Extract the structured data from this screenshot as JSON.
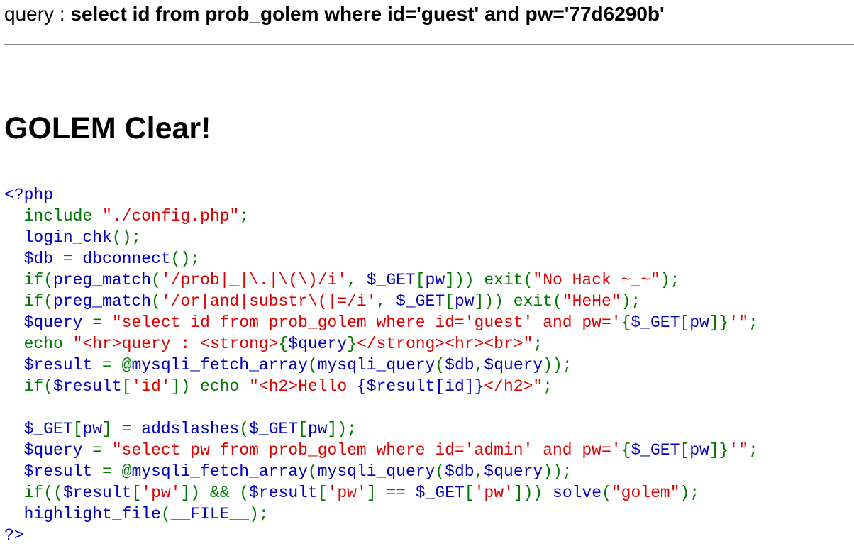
{
  "header": {
    "query_label": "query : ",
    "query_text": "select id from prob_golem where id='guest' and pw='77d6290b'"
  },
  "result": {
    "title": "GOLEM Clear!"
  },
  "source": {
    "lines": [
      [
        [
          "df",
          "<?php"
        ]
      ],
      [
        [
          "df",
          "  "
        ],
        [
          "kw",
          "include "
        ],
        [
          "str",
          "\"./config.php\""
        ],
        [
          "kw",
          ";"
        ]
      ],
      [
        [
          "df",
          "  login_chk"
        ],
        [
          "kw",
          "();"
        ]
      ],
      [
        [
          "df",
          "  $db "
        ],
        [
          "kw",
          "= "
        ],
        [
          "df",
          "dbconnect"
        ],
        [
          "kw",
          "();"
        ]
      ],
      [
        [
          "kw",
          "  if("
        ],
        [
          "df",
          "preg_match"
        ],
        [
          "kw",
          "("
        ],
        [
          "str",
          "'/prob|_|\\.|\\(\\)/i'"
        ],
        [
          "kw",
          ", "
        ],
        [
          "df",
          "$_GET"
        ],
        [
          "kw",
          "["
        ],
        [
          "df",
          "pw"
        ],
        [
          "kw",
          "])) exit("
        ],
        [
          "str",
          "\"No Hack ~_~\""
        ],
        [
          "kw",
          ");"
        ]
      ],
      [
        [
          "kw",
          "  if("
        ],
        [
          "df",
          "preg_match"
        ],
        [
          "kw",
          "("
        ],
        [
          "str",
          "'/or|and|substr\\(|=/i'"
        ],
        [
          "kw",
          ", "
        ],
        [
          "df",
          "$_GET"
        ],
        [
          "kw",
          "["
        ],
        [
          "df",
          "pw"
        ],
        [
          "kw",
          "])) exit("
        ],
        [
          "str",
          "\"HeHe\""
        ],
        [
          "kw",
          ");"
        ]
      ],
      [
        [
          "df",
          "  $query "
        ],
        [
          "kw",
          "= "
        ],
        [
          "str",
          "\"select id from prob_golem where id='guest' and pw='"
        ],
        [
          "kw",
          "{"
        ],
        [
          "df",
          "$_GET"
        ],
        [
          "kw",
          "["
        ],
        [
          "df",
          "pw"
        ],
        [
          "kw",
          "]}"
        ],
        [
          "str",
          "'\""
        ],
        [
          "kw",
          ";"
        ]
      ],
      [
        [
          "kw",
          "  echo "
        ],
        [
          "str",
          "\"<hr>query : <strong>"
        ],
        [
          "kw",
          "{"
        ],
        [
          "df",
          "$query"
        ],
        [
          "kw",
          "}"
        ],
        [
          "str",
          "</strong><hr><br>\""
        ],
        [
          "kw",
          ";"
        ]
      ],
      [
        [
          "df",
          "  $result "
        ],
        [
          "kw",
          "= @"
        ],
        [
          "df",
          "mysqli_fetch_array"
        ],
        [
          "kw",
          "("
        ],
        [
          "df",
          "mysqli_query"
        ],
        [
          "kw",
          "("
        ],
        [
          "df",
          "$db"
        ],
        [
          "kw",
          ","
        ],
        [
          "df",
          "$query"
        ],
        [
          "kw",
          "));"
        ]
      ],
      [
        [
          "kw",
          "  if("
        ],
        [
          "df",
          "$result"
        ],
        [
          "kw",
          "["
        ],
        [
          "str",
          "'id'"
        ],
        [
          "kw",
          "]) echo "
        ],
        [
          "str",
          "\"<h2>Hello "
        ],
        [
          "df",
          "{$result[id]}"
        ],
        [
          "str",
          "</h2>\""
        ],
        [
          "kw",
          ";"
        ]
      ],
      [
        [
          "df",
          ""
        ]
      ],
      [
        [
          "df",
          "  $_GET"
        ],
        [
          "kw",
          "["
        ],
        [
          "df",
          "pw"
        ],
        [
          "kw",
          "] = "
        ],
        [
          "df",
          "addslashes"
        ],
        [
          "kw",
          "("
        ],
        [
          "df",
          "$_GET"
        ],
        [
          "kw",
          "["
        ],
        [
          "df",
          "pw"
        ],
        [
          "kw",
          "]);"
        ]
      ],
      [
        [
          "df",
          "  $query "
        ],
        [
          "kw",
          "= "
        ],
        [
          "str",
          "\"select pw from prob_golem where id='admin' and pw='"
        ],
        [
          "kw",
          "{"
        ],
        [
          "df",
          "$_GET"
        ],
        [
          "kw",
          "["
        ],
        [
          "df",
          "pw"
        ],
        [
          "kw",
          "]}"
        ],
        [
          "str",
          "'\""
        ],
        [
          "kw",
          ";"
        ]
      ],
      [
        [
          "df",
          "  $result "
        ],
        [
          "kw",
          "= @"
        ],
        [
          "df",
          "mysqli_fetch_array"
        ],
        [
          "kw",
          "("
        ],
        [
          "df",
          "mysqli_query"
        ],
        [
          "kw",
          "("
        ],
        [
          "df",
          "$db"
        ],
        [
          "kw",
          ","
        ],
        [
          "df",
          "$query"
        ],
        [
          "kw",
          "));"
        ]
      ],
      [
        [
          "kw",
          "  if(("
        ],
        [
          "df",
          "$result"
        ],
        [
          "kw",
          "["
        ],
        [
          "str",
          "'pw'"
        ],
        [
          "kw",
          "]) && ("
        ],
        [
          "df",
          "$result"
        ],
        [
          "kw",
          "["
        ],
        [
          "str",
          "'pw'"
        ],
        [
          "kw",
          "] == "
        ],
        [
          "df",
          "$_GET"
        ],
        [
          "kw",
          "["
        ],
        [
          "str",
          "'pw'"
        ],
        [
          "kw",
          "])) "
        ],
        [
          "df",
          "solve"
        ],
        [
          "kw",
          "("
        ],
        [
          "str",
          "\"golem\""
        ],
        [
          "kw",
          ");"
        ]
      ],
      [
        [
          "df",
          "  highlight_file"
        ],
        [
          "kw",
          "("
        ],
        [
          "df",
          "__FILE__"
        ],
        [
          "kw",
          ");"
        ]
      ],
      [
        [
          "df",
          "?>"
        ]
      ]
    ]
  }
}
